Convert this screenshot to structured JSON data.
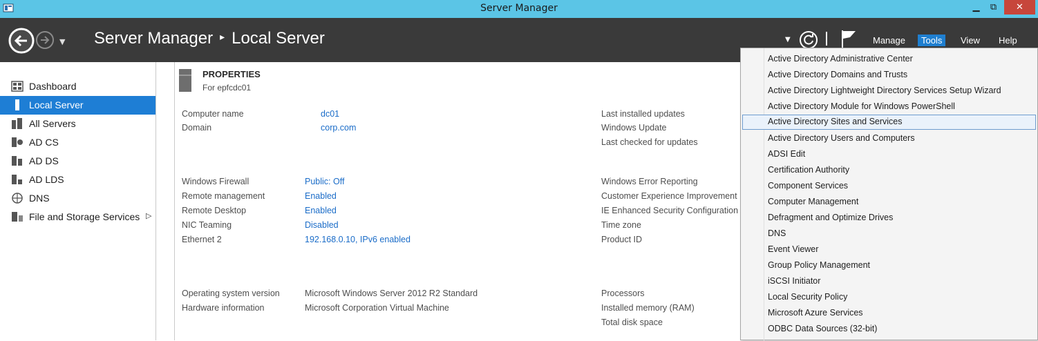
{
  "window": {
    "title": "Server Manager",
    "controls": [
      "minimize",
      "restore",
      "close"
    ]
  },
  "header": {
    "breadcrumb_root": "Server Manager",
    "breadcrumb_separator": "▸",
    "breadcrumb_page": "Local Server",
    "menus": {
      "manage": "Manage",
      "tools": "Tools",
      "view": "View",
      "help": "Help"
    },
    "active_menu": "Tools",
    "accent_color": "#1f7fd0"
  },
  "sidebar": {
    "items": [
      {
        "label": "Dashboard",
        "icon": "dashboard-icon"
      },
      {
        "label": "Local Server",
        "icon": "server-icon",
        "active": true
      },
      {
        "label": "All Servers",
        "icon": "servers-icon"
      },
      {
        "label": "AD CS",
        "icon": "certificate-server-icon"
      },
      {
        "label": "AD DS",
        "icon": "directory-server-icon"
      },
      {
        "label": "AD LDS",
        "icon": "ldap-server-icon"
      },
      {
        "label": "DNS",
        "icon": "dns-icon"
      },
      {
        "label": "File and Storage Services",
        "icon": "storage-icon",
        "has_children": true
      }
    ],
    "expand_glyph": "▷"
  },
  "properties": {
    "title": "PROPERTIES",
    "subtitle": "For epfcdc01",
    "computer_name_label": "Computer name",
    "computer_name_value": "dc01",
    "domain_label": "Domain",
    "domain_value": "corp.com",
    "firewall_label": "Windows Firewall",
    "firewall_value": "Public: Off",
    "remote_mgmt_label": "Remote management",
    "remote_mgmt_value": "Enabled",
    "remote_desktop_label": "Remote Desktop",
    "remote_desktop_value": "Enabled",
    "nic_teaming_label": "NIC Teaming",
    "nic_teaming_value": "Disabled",
    "ethernet_label": "Ethernet 2",
    "ethernet_value": "192.168.0.10, IPv6 enabled",
    "os_label": "Operating system version",
    "os_value": "Microsoft Windows Server 2012 R2 Standard",
    "hardware_label": "Hardware information",
    "hardware_value": "Microsoft Corporation Virtual Machine",
    "last_updates_label": "Last installed updates",
    "windows_update_label": "Windows Update",
    "last_checked_label": "Last checked for updates",
    "error_reporting_label": "Windows Error Reporting",
    "ceip_label": "Customer Experience Improvement P",
    "ie_esc_label": "IE Enhanced Security Configuration",
    "timezone_label": "Time zone",
    "product_id_label": "Product ID",
    "processors_label": "Processors",
    "memory_label": "Installed memory (RAM)",
    "disk_label": "Total disk space"
  },
  "tools_menu": {
    "items": [
      "Active Directory Administrative Center",
      "Active Directory Domains and Trusts",
      "Active Directory Lightweight Directory Services Setup Wizard",
      "Active Directory Module for Windows PowerShell",
      "Active Directory Sites and Services",
      "Active Directory Users and Computers",
      "ADSI Edit",
      "Certification Authority",
      "Component Services",
      "Computer Management",
      "Defragment and Optimize Drives",
      "DNS",
      "Event Viewer",
      "Group Policy Management",
      "iSCSI Initiator",
      "Local Security Policy",
      "Microsoft Azure Services",
      "ODBC Data Sources (32-bit)"
    ],
    "highlighted_item": "Active Directory Sites and Services"
  }
}
